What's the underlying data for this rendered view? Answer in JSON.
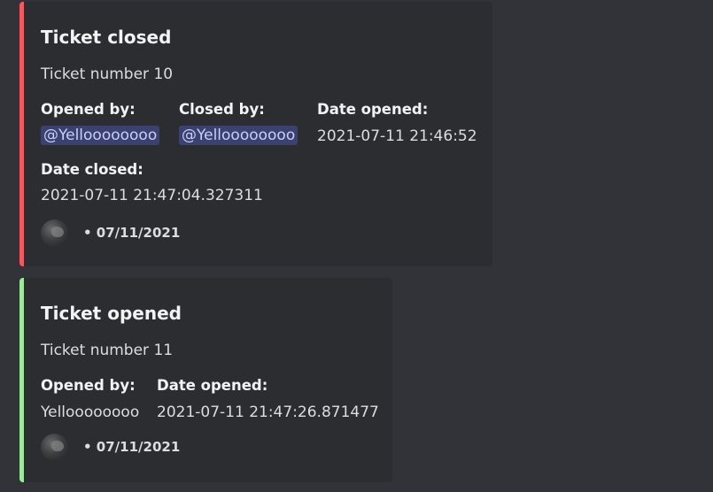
{
  "embeds": [
    {
      "accent_color": "#ef5b60",
      "title": "Ticket closed",
      "description": "Ticket number 10",
      "fields": {
        "opened_by": {
          "name": "Opened by:",
          "value": "@Yelloooooooo"
        },
        "closed_by": {
          "name": "Closed by:",
          "value": "@Yelloooooooo"
        },
        "date_opened": {
          "name": "Date opened:",
          "value": "2021-07-11 21:46:52"
        },
        "date_closed": {
          "name": "Date closed:",
          "value": "2021-07-11 21:47:04.327311"
        }
      },
      "footer": {
        "avatar_icon": "avatar-icon",
        "timestamp": "• 07/11/2021"
      }
    },
    {
      "accent_color": "#9ee79c",
      "title": "Ticket opened",
      "description": "Ticket number 11",
      "fields": {
        "opened_by": {
          "name": "Opened by:",
          "value": "Yelloooooooo"
        },
        "date_opened": {
          "name": "Date opened:",
          "value": "2021-07-11 21:47:26.871477"
        }
      },
      "footer": {
        "avatar_icon": "avatar-icon",
        "timestamp": "• 07/11/2021"
      }
    }
  ]
}
